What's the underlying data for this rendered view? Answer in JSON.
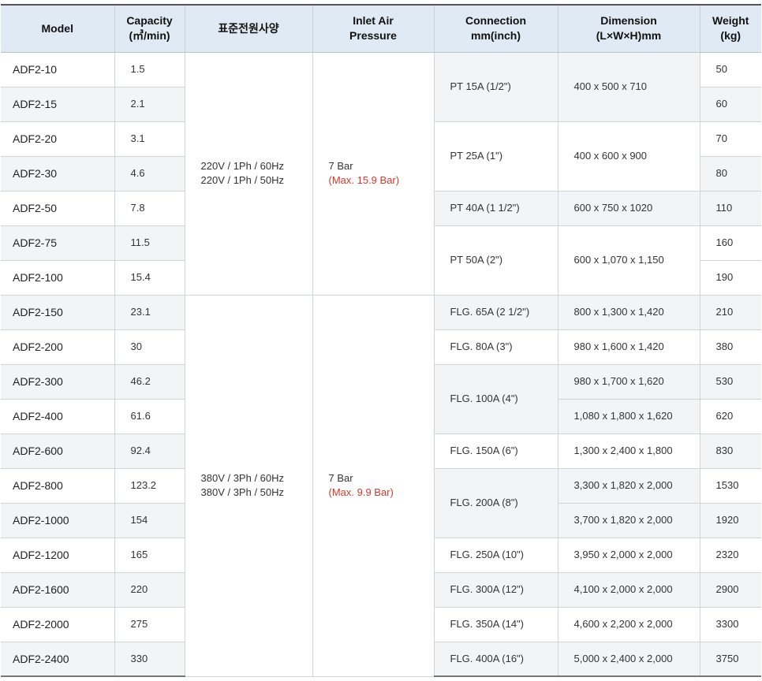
{
  "headers": {
    "model": "Model",
    "capacity_line1": "Capacity",
    "capacity_line2": "(㎥/min)",
    "power": "표준전원사양",
    "pressure_line1": "Inlet Air",
    "pressure_line2": "Pressure",
    "connection_line1": "Connection",
    "connection_line2": "mm(inch)",
    "dimension_line1": "Dimension",
    "dimension_line2": "(L×W×H)mm",
    "weight_line1": "Weight",
    "weight_line2": "(kg)"
  },
  "power": [
    {
      "line1": "220V / 1Ph / 60Hz",
      "line2": "220V / 1Ph / 50Hz"
    },
    {
      "line1": "380V / 3Ph / 60Hz",
      "line2": "380V / 3Ph / 50Hz"
    }
  ],
  "pressure": [
    {
      "value": "7 Bar",
      "max": "(Max. 15.9 Bar)"
    },
    {
      "value": "7 Bar",
      "max": "(Max. 9.9 Bar)"
    }
  ],
  "connections": [
    "PT 15A (1/2\")",
    "PT 25A (1\")",
    "PT 40A (1 1/2\")",
    "PT 50A (2\")",
    "FLG. 65A (2 1/2\")",
    "FLG. 80A (3\")",
    "FLG. 100A (4\")",
    "FLG. 150A (6\")",
    "FLG. 200A (8\")",
    "FLG. 250A (10\")",
    "FLG. 300A (12\")",
    "FLG. 350A (14\")",
    "FLG. 400A (16\")"
  ],
  "dimensions": [
    "400 x 500 x 710",
    "400 x 600 x 900",
    "600 x 750 x 1020",
    "600 x 1,070 x 1,150",
    "800 x 1,300 x 1,420",
    "980 x 1,600 x 1,420",
    "980 x 1,700 x 1,620",
    "1,080 x 1,800 x 1,620",
    "1,300 x 2,400 x 1,800",
    "3,300 x 1,820 x 2,000",
    "3,700 x 1,820 x 2,000",
    "3,950 x 2,000 x 2,000",
    "4,100 x 2,000 x 2,000",
    "4,600 x 2,200 x 2,000",
    "5,000 x 2,400 x 2,000"
  ],
  "rows": [
    {
      "model": "ADF2-10",
      "capacity": "1.5",
      "weight": "50"
    },
    {
      "model": "ADF2-15",
      "capacity": "2.1",
      "weight": "60"
    },
    {
      "model": "ADF2-20",
      "capacity": "3.1",
      "weight": "70"
    },
    {
      "model": "ADF2-30",
      "capacity": "4.6",
      "weight": "80"
    },
    {
      "model": "ADF2-50",
      "capacity": "7.8",
      "weight": "110"
    },
    {
      "model": "ADF2-75",
      "capacity": "11.5",
      "weight": "160"
    },
    {
      "model": "ADF2-100",
      "capacity": "15.4",
      "weight": "190"
    },
    {
      "model": "ADF2-150",
      "capacity": "23.1",
      "weight": "210"
    },
    {
      "model": "ADF2-200",
      "capacity": "30",
      "weight": "380"
    },
    {
      "model": "ADF2-300",
      "capacity": "46.2",
      "weight": "530"
    },
    {
      "model": "ADF2-400",
      "capacity": "61.6",
      "weight": "620"
    },
    {
      "model": "ADF2-600",
      "capacity": "92.4",
      "weight": "830"
    },
    {
      "model": "ADF2-800",
      "capacity": "123.2",
      "weight": "1530"
    },
    {
      "model": "ADF2-1000",
      "capacity": "154",
      "weight": "1920"
    },
    {
      "model": "ADF2-1200",
      "capacity": "165",
      "weight": "2320"
    },
    {
      "model": "ADF2-1600",
      "capacity": "220",
      "weight": "2900"
    },
    {
      "model": "ADF2-2000",
      "capacity": "275",
      "weight": "3300"
    },
    {
      "model": "ADF2-2400",
      "capacity": "330",
      "weight": "3750"
    }
  ],
  "colors": {
    "header_bg": "#dfeaf5",
    "shade_bg": "#f2f4f6",
    "max_pressure_text": "#d6392b"
  }
}
